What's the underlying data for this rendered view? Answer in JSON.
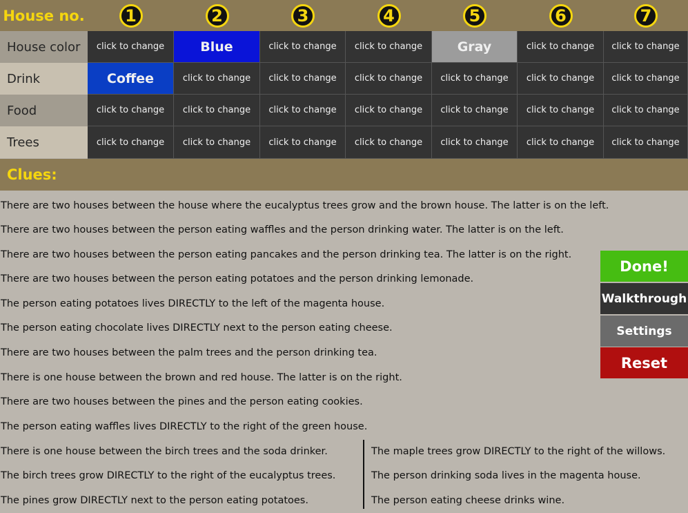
{
  "header": {
    "corner_label": "House no.",
    "house_numbers": [
      "1",
      "2",
      "3",
      "4",
      "5",
      "6",
      "7"
    ]
  },
  "rows": [
    {
      "label": "House color",
      "cells": [
        "click to change",
        "Blue",
        "click to change",
        "click to change",
        "Gray",
        "click to change",
        "click to change"
      ]
    },
    {
      "label": "Drink",
      "cells": [
        "Coffee",
        "click to change",
        "click to change",
        "click to change",
        "click to change",
        "click to change",
        "click to change"
      ]
    },
    {
      "label": "Food",
      "cells": [
        "click to change",
        "click to change",
        "click to change",
        "click to change",
        "click to change",
        "click to change",
        "click to change"
      ]
    },
    {
      "label": "Trees",
      "cells": [
        "click to change",
        "click to change",
        "click to change",
        "click to change",
        "click to change",
        "click to change",
        "click to change"
      ]
    }
  ],
  "cell_colors": {
    "Blue": "#0a14d8",
    "Gray": "#9c9c9c",
    "Coffee": "#0a3ec4",
    "default": "#333333"
  },
  "clues_label": "Clues:",
  "clues_left": [
    "There are two houses between the house where the eucalyptus trees grow and the brown house. The latter is on the left.",
    "There are two houses between the person eating waffles and the person drinking water. The latter is on the left.",
    "There are two houses between the person eating pancakes and the person drinking tea. The latter is on the right.",
    "There are two houses between the person eating potatoes and the person drinking lemonade.",
    "The person eating potatoes lives DIRECTLY to the left of the magenta house.",
    "The person eating chocolate lives DIRECTLY next to the person eating cheese.",
    "There are two houses between the palm trees and the person drinking tea.",
    "There is one house between the brown and red house. The latter is on the right.",
    "There are two houses between the pines and the person eating cookies.",
    "The person eating waffles lives DIRECTLY to the right of the green house.",
    "There is one house between the birch trees and the soda drinker.",
    "The birch trees grow DIRECTLY to the right of the eucalyptus trees.",
    "The pines grow DIRECTLY next to the person eating potatoes."
  ],
  "clues_right": [
    "The maple trees grow DIRECTLY to the right of the willows.",
    "The person drinking soda lives in the magenta house.",
    "The person eating cheese drinks wine."
  ],
  "buttons": {
    "done": "Done!",
    "walkthrough": "Walkthrough",
    "settings": "Settings",
    "reset": "Reset"
  },
  "button_colors": {
    "done": "#46bd12",
    "walkthrough": "#333333",
    "settings": "#6b6b6b",
    "reset": "#b00f0f"
  }
}
